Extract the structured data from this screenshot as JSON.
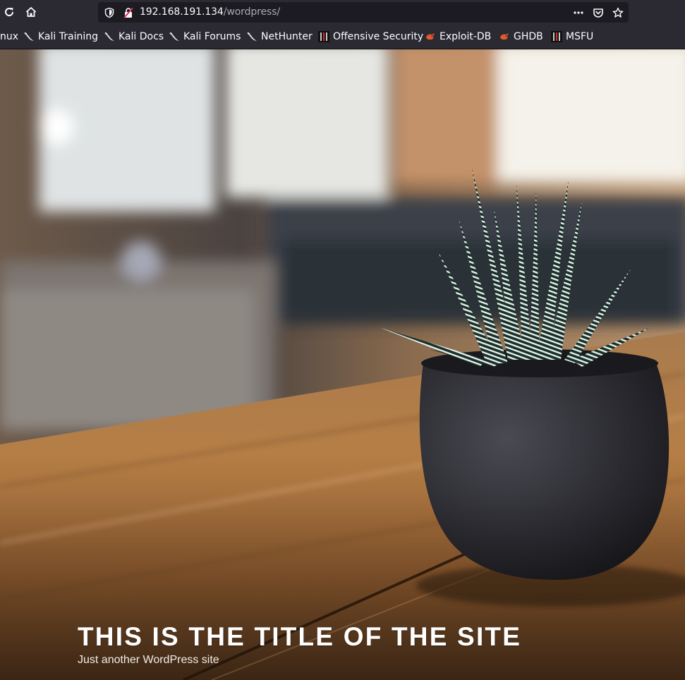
{
  "browser": {
    "url_host": "192.168.191.134",
    "url_path": "/wordpress/",
    "icons": {
      "reload": "reload-icon",
      "home": "home-icon",
      "tracking": "tracking-protection-icon",
      "insecure": "insecure-connection-icon",
      "page_actions": "more-actions-icon",
      "pocket": "pocket-icon",
      "bookmark": "bookmark-star-icon"
    }
  },
  "bookmarks": [
    {
      "label": "nux",
      "icon": "none"
    },
    {
      "label": "Kali Training",
      "icon": "kali-dragon-icon"
    },
    {
      "label": "Kali Docs",
      "icon": "kali-dragon-icon"
    },
    {
      "label": "Kali Forums",
      "icon": "kali-dragon-icon"
    },
    {
      "label": "NetHunter",
      "icon": "kali-dragon-icon"
    },
    {
      "label": "Offensive Security",
      "icon": "offsec-icon"
    },
    {
      "label": "Exploit-DB",
      "icon": "exploit-db-icon"
    },
    {
      "label": "GHDB",
      "icon": "exploit-db-icon"
    },
    {
      "label": "MSFU",
      "icon": "offsec-icon"
    }
  ],
  "site": {
    "title": "THIS IS THE TITLE OF THE SITE",
    "tagline": "Just another WordPress site",
    "header_image": "potted-succulent-on-wooden-table"
  },
  "colors": {
    "chrome_bg": "#2b2a33",
    "urlbar_bg": "#1c1b22",
    "accent_insecure": "#e22850"
  }
}
